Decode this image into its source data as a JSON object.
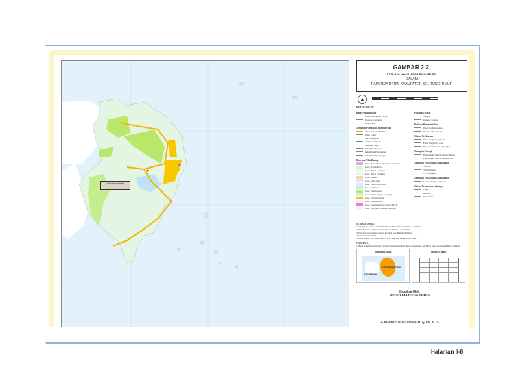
{
  "title_block": {
    "figure": "GAMBAR 2.2.",
    "line1": "LOKASI RENCANA KEGIATAN",
    "line2": "DALAM",
    "line3": "RAPERDA RTRW KABUPATEN BELITUNG TIMUR"
  },
  "map": {
    "callout": "Lokasi Rencana Kegiatan",
    "label_left": "Kab. Belitung",
    "colors": {
      "sea": "#e3f1fb",
      "land": "#e4f5e4",
      "agri": "#b8e86a",
      "road": "#f2b400"
    }
  },
  "legend": {
    "heading": "KETERANGAN",
    "admin": {
      "title": "Batas Administrasi",
      "items": [
        "Batas Kabupaten / Kota",
        "Batas Kecamatan",
        "Batas Desa"
      ]
    },
    "transport": {
      "title": "Jaringan Prasarana Transportasi",
      "items": [
        "Jalan Kolektor Primer",
        "Jalan Lokal",
        "Alur Pelayaran",
        "Terminal Tipe B",
        "Terminal Tipe C",
        "Pelabuhan Khusus",
        "Pelabuhan Pengumpan",
        "Pelabuhan Pengumpul"
      ]
    },
    "pola": {
      "title": "Rencana Pola Ruang",
      "items": [
        {
          "label": "Kaw. Peruntukkan Lainnya / Bandara",
          "color": "#e3a6f5"
        },
        {
          "label": "Kaw. Hortikultura",
          "color": "#d4f7d4"
        },
        {
          "label": "Kaw. Hutan Lindung",
          "color": "#e9fbe0"
        },
        {
          "label": "Kaw. Hutan Produksi",
          "color": "#e3f7e3"
        },
        {
          "label": "Kaw. Industri",
          "color": "#e3deb0"
        },
        {
          "label": "Kaw. Pariwisata",
          "color": "#f9d9f3"
        },
        {
          "label": "Kaw. Pelestarian Alam",
          "color": "#e2e8f8"
        },
        {
          "label": "Kaw. Perikanan",
          "color": "#bdf1f1"
        },
        {
          "label": "Kaw. Perkebunan",
          "color": "#b8e86a"
        },
        {
          "label": "Kaw. Perlindungan Setempat",
          "color": "#cdf0cd"
        },
        {
          "label": "Kaw. Pertambangan",
          "color": "#f7c800"
        },
        {
          "label": "Kaw. Permukiman",
          "color": "#f4f4f4"
        },
        {
          "label": "Kaw. Pengembangan Energi PLTU",
          "color": "#ea7ae8"
        },
        {
          "label": "Kaw. Pertanian Tanaman Pangan",
          "color": "#eef4ee"
        }
      ]
    },
    "perairan": {
      "title": "Perairan Darat",
      "items": [
        "Sungai",
        "Danau / Kolong"
      ]
    },
    "ibukota": {
      "title": "Ibukota Pemerintahan",
      "items": [
        "Ibu Kota Kabupaten",
        "Ibu Kota Kecamatan"
      ]
    },
    "perkotaan": {
      "title": "Sistem Perkotaan",
      "items": [
        "Pusat Kegiatan Wilayah",
        "Pusat Kegiatan Lokal",
        "Pusat Pelayanan Lingkungan"
      ]
    },
    "energi": {
      "title": "Jaringan Energi",
      "items": [
        "Pembangkit Listrik Tenaga Diesel",
        "Pembangkit Listrik Tenaga Uap"
      ]
    },
    "lingkungan": {
      "title": "Jaringan Prasarana Lingkungan",
      "items": [
        "SPALD",
        "TPA Sampah",
        "TPS Sampah"
      ]
    },
    "telekom": {
      "title": "Jaringan Prasarana Lingkungan",
      "items": [
        "Stasiun Telepon Otomat"
      ]
    },
    "lainnya": {
      "title": "Sistem Prasarana Lainnya",
      "items": [
        "SPBU",
        "RSUD",
        "Puskesmas"
      ]
    },
    "sumber_title": "SUMBER DATA :",
    "sumber": [
      "1. Sebagai Peta Dasar adalah Peta Rupa Bumi Indonesia Skala 1 : 50.000",
      "2. Peta Rencana Struktur Ruang Nasional Skala 1 : 2.500.000",
      "3. Peta Rencana Struktur Ruang Provinsi Kep. Bangka Belitung",
      "4. Survey Primer 2013",
      "5. Hasil Sospro Tim Teknis RTRW Kab. Belitung Timur Tahun 2014"
    ],
    "catatan_title": "CATATAN :",
    "catatan": "1. Batas Administrasi (Batas Provinsi, Batas Kabupaten, Batas Kecamatan, dan Batas Desa) merupakan Batas Indikatif",
    "diagram_title": "Diagram Lokasi",
    "diagram_label_east": "Kab. Belitung Timur",
    "diagram_label_west": "Kab. Belitung",
    "index_title": "Indeks Lokasi",
    "disahkan": "Disahkan Oleh,",
    "bupati": "BUPATI BELITUNG TIMUR",
    "signer": "dr. BASURI TJAHAJA PURNAMA, Sp. GK., M. Gz"
  },
  "footer": {
    "page": "Halaman II-8"
  }
}
